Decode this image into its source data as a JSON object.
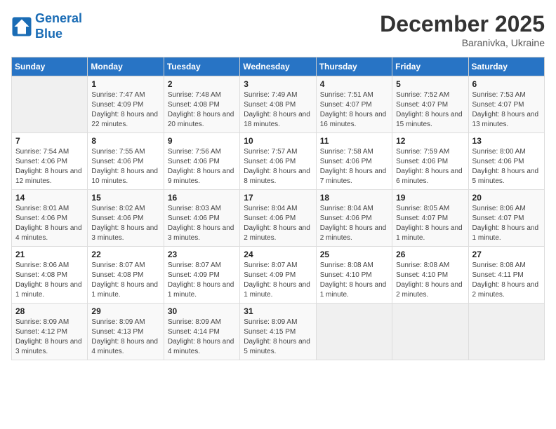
{
  "header": {
    "logo_line1": "General",
    "logo_line2": "Blue",
    "month_year": "December 2025",
    "location": "Baranivka, Ukraine"
  },
  "days_of_week": [
    "Sunday",
    "Monday",
    "Tuesday",
    "Wednesday",
    "Thursday",
    "Friday",
    "Saturday"
  ],
  "weeks": [
    [
      {
        "day": "",
        "sunrise": "",
        "sunset": "",
        "daylight": ""
      },
      {
        "day": "1",
        "sunrise": "7:47 AM",
        "sunset": "4:09 PM",
        "daylight": "8 hours and 22 minutes."
      },
      {
        "day": "2",
        "sunrise": "7:48 AM",
        "sunset": "4:08 PM",
        "daylight": "8 hours and 20 minutes."
      },
      {
        "day": "3",
        "sunrise": "7:49 AM",
        "sunset": "4:08 PM",
        "daylight": "8 hours and 18 minutes."
      },
      {
        "day": "4",
        "sunrise": "7:51 AM",
        "sunset": "4:07 PM",
        "daylight": "8 hours and 16 minutes."
      },
      {
        "day": "5",
        "sunrise": "7:52 AM",
        "sunset": "4:07 PM",
        "daylight": "8 hours and 15 minutes."
      },
      {
        "day": "6",
        "sunrise": "7:53 AM",
        "sunset": "4:07 PM",
        "daylight": "8 hours and 13 minutes."
      }
    ],
    [
      {
        "day": "7",
        "sunrise": "7:54 AM",
        "sunset": "4:06 PM",
        "daylight": "8 hours and 12 minutes."
      },
      {
        "day": "8",
        "sunrise": "7:55 AM",
        "sunset": "4:06 PM",
        "daylight": "8 hours and 10 minutes."
      },
      {
        "day": "9",
        "sunrise": "7:56 AM",
        "sunset": "4:06 PM",
        "daylight": "8 hours and 9 minutes."
      },
      {
        "day": "10",
        "sunrise": "7:57 AM",
        "sunset": "4:06 PM",
        "daylight": "8 hours and 8 minutes."
      },
      {
        "day": "11",
        "sunrise": "7:58 AM",
        "sunset": "4:06 PM",
        "daylight": "8 hours and 7 minutes."
      },
      {
        "day": "12",
        "sunrise": "7:59 AM",
        "sunset": "4:06 PM",
        "daylight": "8 hours and 6 minutes."
      },
      {
        "day": "13",
        "sunrise": "8:00 AM",
        "sunset": "4:06 PM",
        "daylight": "8 hours and 5 minutes."
      }
    ],
    [
      {
        "day": "14",
        "sunrise": "8:01 AM",
        "sunset": "4:06 PM",
        "daylight": "8 hours and 4 minutes."
      },
      {
        "day": "15",
        "sunrise": "8:02 AM",
        "sunset": "4:06 PM",
        "daylight": "8 hours and 3 minutes."
      },
      {
        "day": "16",
        "sunrise": "8:03 AM",
        "sunset": "4:06 PM",
        "daylight": "8 hours and 3 minutes."
      },
      {
        "day": "17",
        "sunrise": "8:04 AM",
        "sunset": "4:06 PM",
        "daylight": "8 hours and 2 minutes."
      },
      {
        "day": "18",
        "sunrise": "8:04 AM",
        "sunset": "4:06 PM",
        "daylight": "8 hours and 2 minutes."
      },
      {
        "day": "19",
        "sunrise": "8:05 AM",
        "sunset": "4:07 PM",
        "daylight": "8 hours and 1 minute."
      },
      {
        "day": "20",
        "sunrise": "8:06 AM",
        "sunset": "4:07 PM",
        "daylight": "8 hours and 1 minute."
      }
    ],
    [
      {
        "day": "21",
        "sunrise": "8:06 AM",
        "sunset": "4:08 PM",
        "daylight": "8 hours and 1 minute."
      },
      {
        "day": "22",
        "sunrise": "8:07 AM",
        "sunset": "4:08 PM",
        "daylight": "8 hours and 1 minute."
      },
      {
        "day": "23",
        "sunrise": "8:07 AM",
        "sunset": "4:09 PM",
        "daylight": "8 hours and 1 minute."
      },
      {
        "day": "24",
        "sunrise": "8:07 AM",
        "sunset": "4:09 PM",
        "daylight": "8 hours and 1 minute."
      },
      {
        "day": "25",
        "sunrise": "8:08 AM",
        "sunset": "4:10 PM",
        "daylight": "8 hours and 1 minute."
      },
      {
        "day": "26",
        "sunrise": "8:08 AM",
        "sunset": "4:10 PM",
        "daylight": "8 hours and 2 minutes."
      },
      {
        "day": "27",
        "sunrise": "8:08 AM",
        "sunset": "4:11 PM",
        "daylight": "8 hours and 2 minutes."
      }
    ],
    [
      {
        "day": "28",
        "sunrise": "8:09 AM",
        "sunset": "4:12 PM",
        "daylight": "8 hours and 3 minutes."
      },
      {
        "day": "29",
        "sunrise": "8:09 AM",
        "sunset": "4:13 PM",
        "daylight": "8 hours and 4 minutes."
      },
      {
        "day": "30",
        "sunrise": "8:09 AM",
        "sunset": "4:14 PM",
        "daylight": "8 hours and 4 minutes."
      },
      {
        "day": "31",
        "sunrise": "8:09 AM",
        "sunset": "4:15 PM",
        "daylight": "8 hours and 5 minutes."
      },
      {
        "day": "",
        "sunrise": "",
        "sunset": "",
        "daylight": ""
      },
      {
        "day": "",
        "sunrise": "",
        "sunset": "",
        "daylight": ""
      },
      {
        "day": "",
        "sunrise": "",
        "sunset": "",
        "daylight": ""
      }
    ]
  ]
}
